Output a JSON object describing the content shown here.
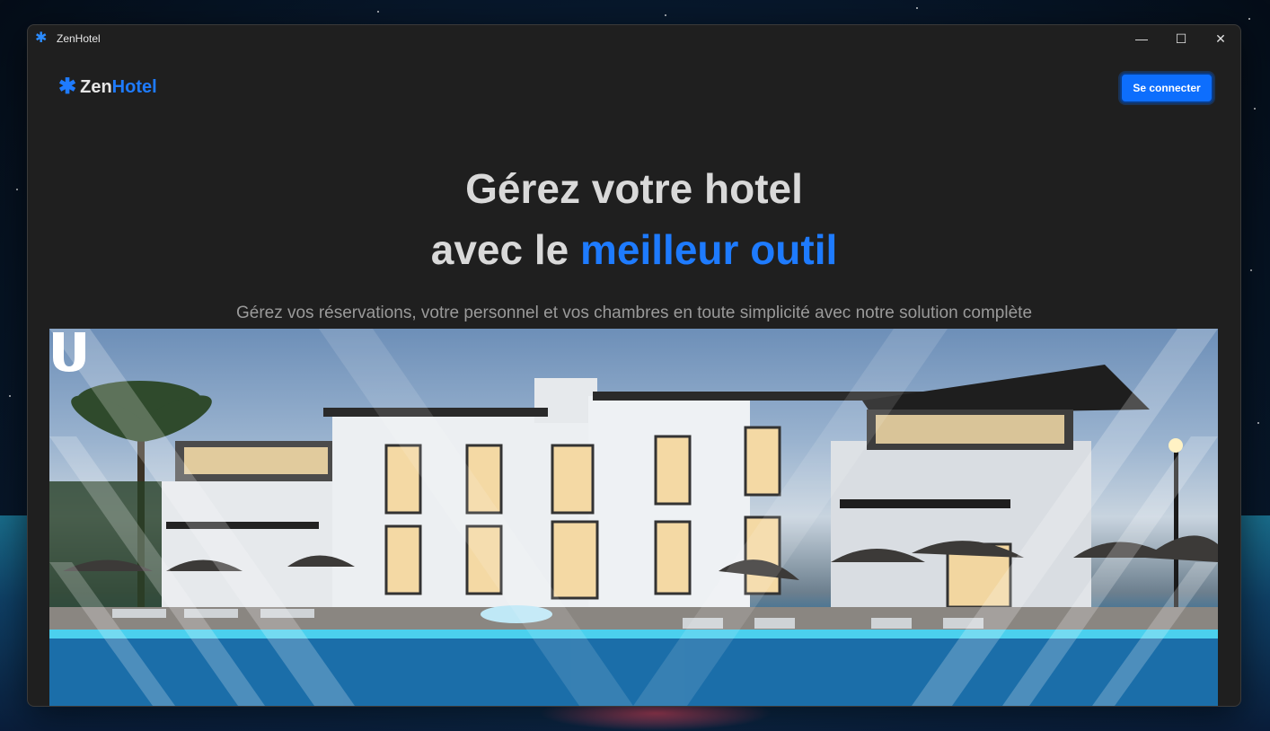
{
  "window": {
    "title": "ZenHotel",
    "app_icon": "asterisk-icon"
  },
  "controls": {
    "minimize": "—",
    "maximize": "☐",
    "close": "✕"
  },
  "navbar": {
    "logo_icon": "✱",
    "logo_part1": "Zen",
    "logo_part2": "Hotel",
    "login_label": "Se connecter"
  },
  "hero": {
    "line1": "Gérez votre hotel",
    "line2_prefix": "avec le ",
    "line2_accent": "meilleur outil",
    "subtitle": "Gérez vos réservations, votre personnel et vos chambres en toute simplicité avec notre solution complète"
  },
  "colors": {
    "accent": "#1e7bff",
    "button": "#0d6efd",
    "window_bg": "#1f1f1f"
  }
}
